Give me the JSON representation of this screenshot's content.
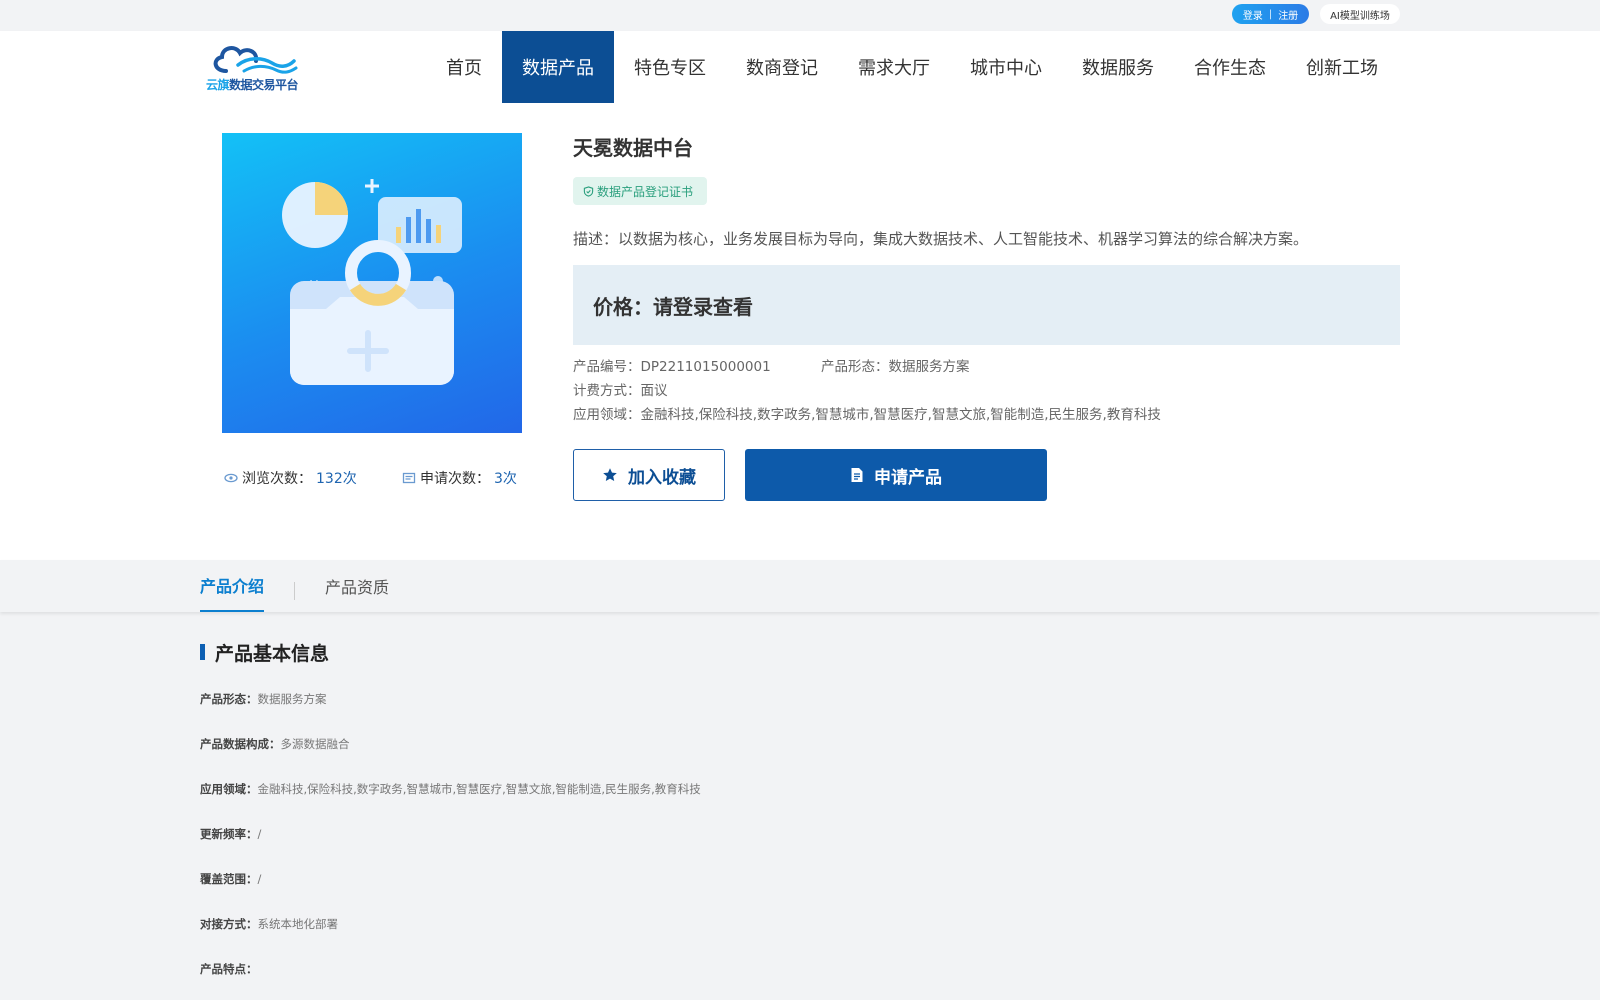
{
  "topbar": {
    "login": "登录",
    "separator": "|",
    "register": "注册",
    "ai_link": "AI模型训练场"
  },
  "logo": {
    "text_part1": "云旗",
    "text_part2": "数据交易平台"
  },
  "nav": {
    "items": [
      {
        "label": "首页"
      },
      {
        "label": "数据产品"
      },
      {
        "label": "特色专区"
      },
      {
        "label": "数商登记"
      },
      {
        "label": "需求大厅"
      },
      {
        "label": "城市中心"
      },
      {
        "label": "数据服务"
      },
      {
        "label": "合作生态"
      },
      {
        "label": "创新工场"
      }
    ],
    "active_index": 1
  },
  "product": {
    "title": "天冕数据中台",
    "cert_label": "数据产品登记证书",
    "description": "描述：以数据为核心，业务发展目标为导向，集成大数据技术、人工智能技术、机器学习算法的综合解决方案。",
    "price": "价格：请登录查看",
    "code_label": "产品编号：",
    "code": "DP2211015000001",
    "form_label": "产品形态：",
    "form": "数据服务方案",
    "billing_label": "计费方式：",
    "billing": "面议",
    "domain_label": "应用领域：",
    "domain": "金融科技,保险科技,数字政务,智慧城市,智慧医疗,智慧文旅,智能制造,民生服务,教育科技",
    "fav_button": "加入收藏",
    "apply_button": "申请产品"
  },
  "stats": {
    "views_label": "浏览次数：",
    "views": "132次",
    "applies_label": "申请次数：",
    "applies": "3次"
  },
  "tabs": [
    {
      "label": "产品介绍"
    },
    {
      "label": "产品资质"
    }
  ],
  "basic_info": {
    "section_title": "产品基本信息",
    "fields": [
      {
        "label": "产品形态：",
        "value": "数据服务方案"
      },
      {
        "label": "产品数据构成：",
        "value": "多源数据融合"
      },
      {
        "label": "应用领域：",
        "value": "金融科技,保险科技,数字政务,智慧城市,智慧医疗,智慧文旅,智能制造,民生服务,教育科技"
      },
      {
        "label": "更新频率：",
        "value": "/"
      },
      {
        "label": "覆盖范围：",
        "value": "/"
      },
      {
        "label": "对接方式：",
        "value": "系统本地化部署"
      },
      {
        "label": "产品特点：",
        "value": ""
      }
    ]
  },
  "colors": {
    "primary": "#0c4e94",
    "accent": "#0c7fcf",
    "cert_green": "#2a9f7d"
  }
}
